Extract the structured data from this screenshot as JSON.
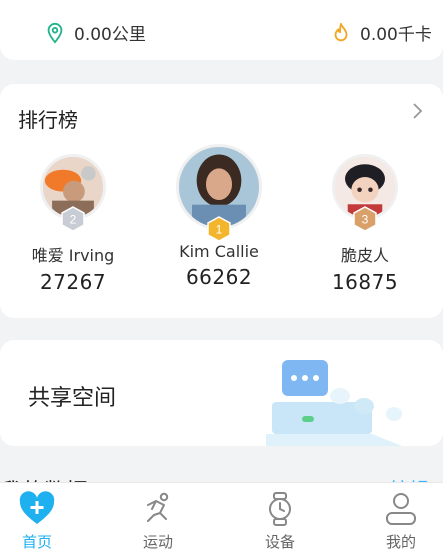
{
  "stats": {
    "distance": "0.00公里",
    "calories": "0.00千卡"
  },
  "ranking": {
    "title": "排行榜",
    "entries": [
      {
        "rank": "2",
        "name": "唯爱 Irving",
        "score": "27267"
      },
      {
        "rank": "1",
        "name": "Kim Callie",
        "score": "66262"
      },
      {
        "rank": "3",
        "name": "脆皮人",
        "score": "16875"
      }
    ]
  },
  "share": {
    "title": "共享空间"
  },
  "my_data": {
    "title": "我的数据",
    "link": "编辑"
  },
  "tabbar": {
    "items": [
      {
        "label": "首页",
        "icon": "heart-plus-icon",
        "active": true
      },
      {
        "label": "运动",
        "icon": "runner-icon",
        "active": false
      },
      {
        "label": "设备",
        "icon": "watch-icon",
        "active": false
      },
      {
        "label": "我的",
        "icon": "person-icon",
        "active": false
      }
    ]
  },
  "colors": {
    "accent": "#1fb0f0",
    "link": "#3ab6ff",
    "location": "#22b38a",
    "fire": "#f2a623"
  }
}
